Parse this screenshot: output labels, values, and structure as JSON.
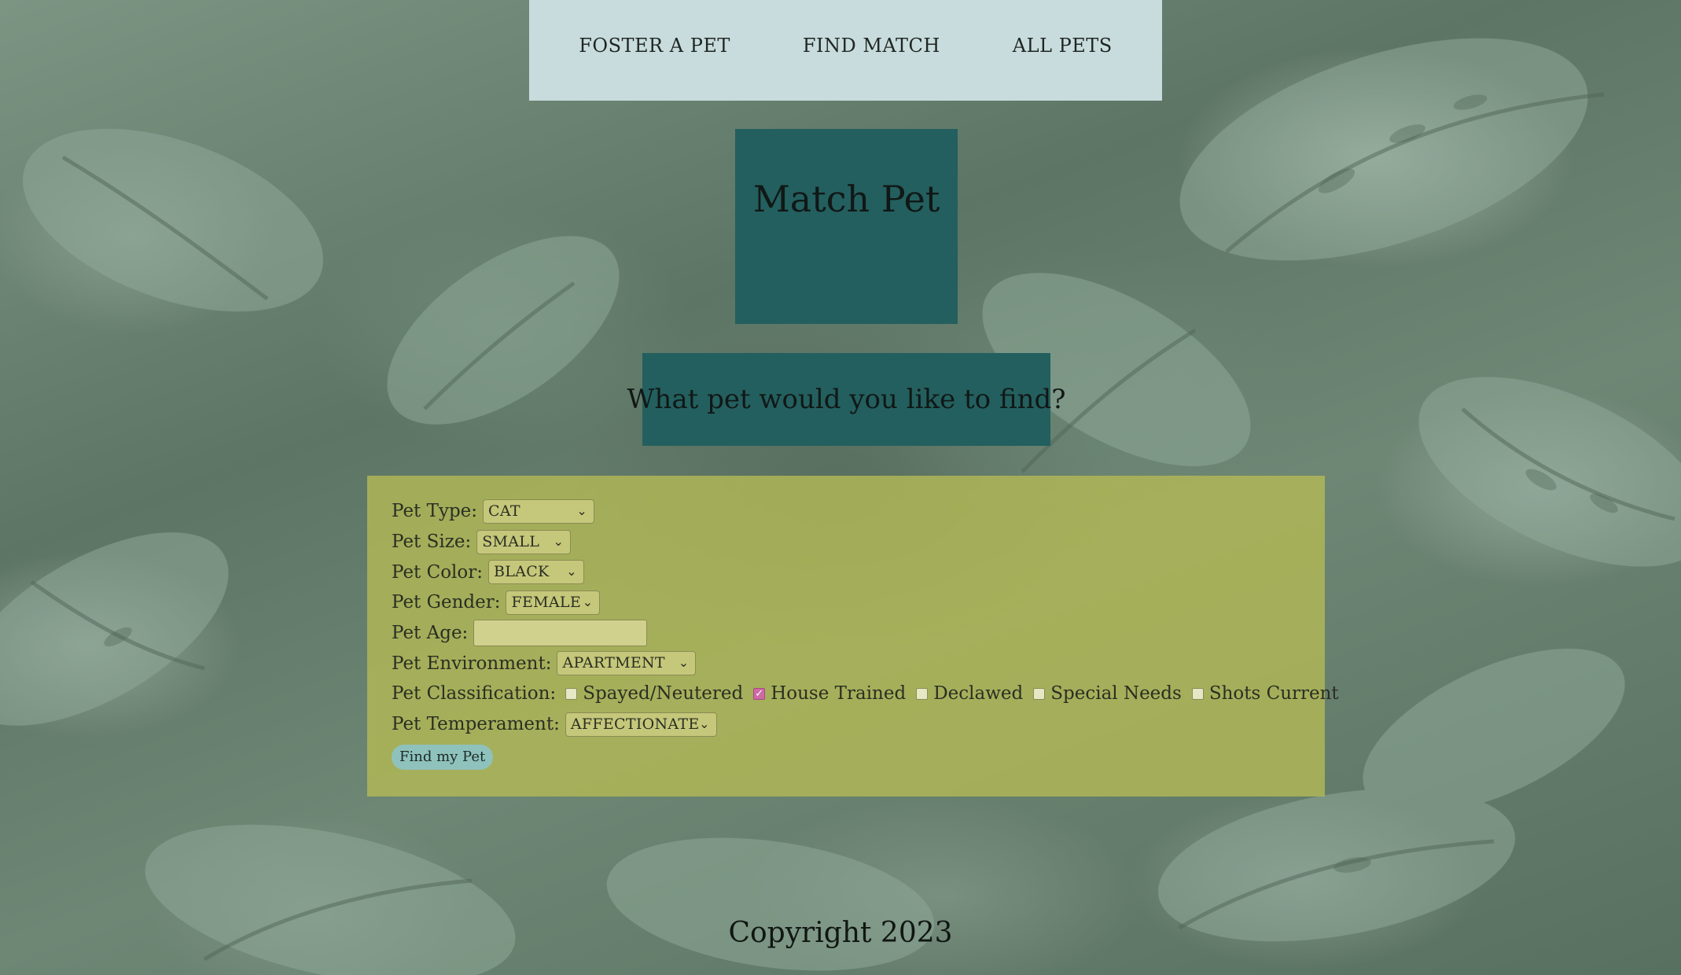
{
  "nav": {
    "items": [
      {
        "label": "FOSTER A PET"
      },
      {
        "label": "FIND MATCH"
      },
      {
        "label": "ALL PETS"
      }
    ]
  },
  "page": {
    "title": "Match Pet",
    "subtitle": "What pet would you like to find?"
  },
  "form": {
    "pet_type": {
      "label": "Pet Type:",
      "selected": "CAT"
    },
    "pet_size": {
      "label": "Pet Size:",
      "selected": "SMALL"
    },
    "pet_color": {
      "label": "Pet Color:",
      "selected": "BLACK"
    },
    "pet_gender": {
      "label": "Pet Gender:",
      "selected": "FEMALE"
    },
    "pet_age": {
      "label": "Pet Age:",
      "value": ""
    },
    "pet_environment": {
      "label": "Pet Environment:",
      "selected": "APARTMENT"
    },
    "pet_classification": {
      "label": "Pet Classification:",
      "options": [
        {
          "label": "Spayed/Neutered",
          "checked": false
        },
        {
          "label": "House Trained",
          "checked": true
        },
        {
          "label": "Declawed",
          "checked": false
        },
        {
          "label": "Special Needs",
          "checked": false
        },
        {
          "label": "Shots Current",
          "checked": false
        }
      ]
    },
    "pet_temperament": {
      "label": "Pet Temperament:",
      "selected": "AFFECTIONATE"
    },
    "submit_label": "Find my Pet"
  },
  "footer": {
    "copyright": "Copyright 2023"
  },
  "colors": {
    "nav_bg": "#c8dcdd",
    "title_bg": "#235f5e",
    "form_bg": "#b2b856",
    "button_bg": "#8fc2bc",
    "checkbox_checked": "#cf6aa6"
  }
}
